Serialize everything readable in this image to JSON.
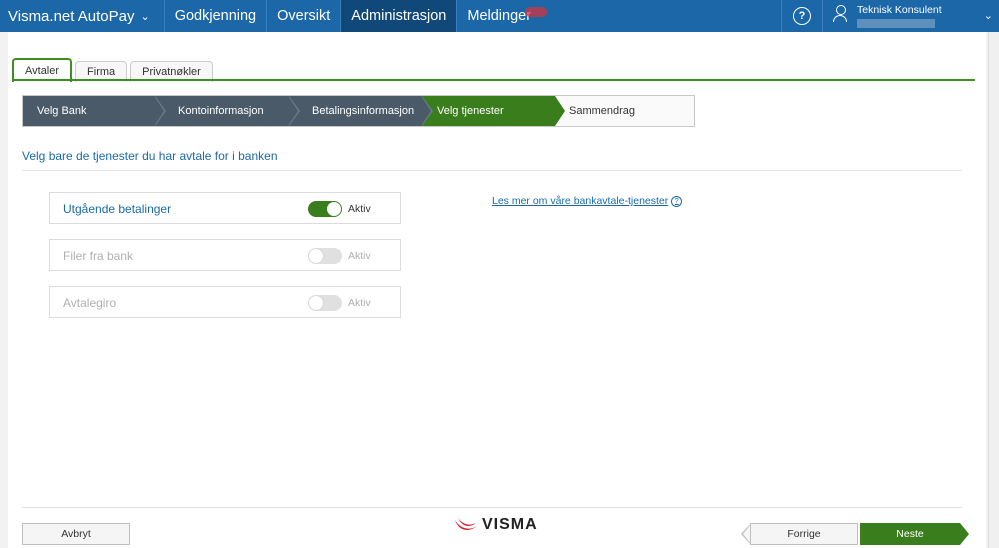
{
  "topnav": {
    "app_title": "Visma.net AutoPay",
    "items": [
      {
        "label": "Godkjenning"
      },
      {
        "label": "Oversikt"
      },
      {
        "label": "Administrasjon"
      },
      {
        "label": "Meldinger"
      }
    ],
    "help_glyph": "?",
    "user_name": "Teknisk Konsulent"
  },
  "tabs": [
    {
      "label": "Avtaler"
    },
    {
      "label": "Firma"
    },
    {
      "label": "Privatnøkler"
    }
  ],
  "wizard": {
    "steps": [
      {
        "label": "Velg Bank"
      },
      {
        "label": "Kontoinformasjon"
      },
      {
        "label": "Betalingsinformasjon"
      },
      {
        "label": "Velg tjenester"
      },
      {
        "label": "Sammendrag"
      }
    ]
  },
  "heading": "Velg bare de tjenester du har avtale for i banken",
  "services": [
    {
      "label": "Utgående betalinger",
      "state": "Aktiv",
      "enabled": true
    },
    {
      "label": "Filer fra bank",
      "state": "Aktiv",
      "enabled": false
    },
    {
      "label": "Avtalegiro",
      "state": "Aktiv",
      "enabled": false
    }
  ],
  "info_link": "Les mer om våre bankavtale-tjenester",
  "footer": {
    "cancel": "Avbryt",
    "previous": "Forrige",
    "next": "Neste",
    "logo_text": "VISMA"
  },
  "colors": {
    "nav_bg": "#1b67a8",
    "nav_active": "#11487a",
    "accent_green": "#3a7d1c",
    "step_dark": "#4b5a68",
    "link_blue": "#1a6aa8"
  }
}
